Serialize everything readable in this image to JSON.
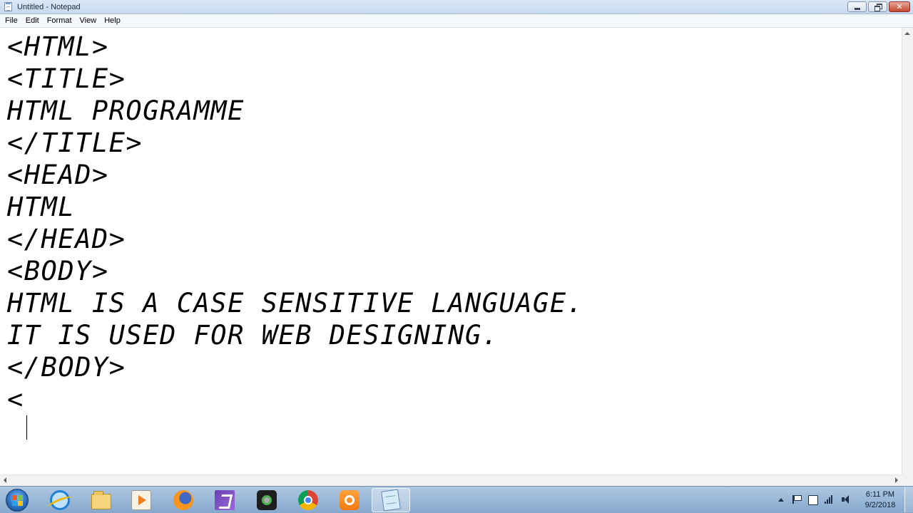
{
  "window": {
    "title": "Untitled - Notepad",
    "close_glyph": "✕"
  },
  "menu": [
    "File",
    "Edit",
    "Format",
    "View",
    "Help"
  ],
  "editor": {
    "lines": [
      "<HTML>",
      "<TITLE>",
      "HTML PROGRAMME",
      "</TITLE>",
      "<HEAD>",
      "HTML",
      "</HEAD>",
      "<BODY>",
      "HTML IS A CASE SENSITIVE LANGUAGE.",
      "IT IS USED FOR WEB DESIGNING.",
      "</BODY>",
      "<"
    ]
  },
  "taskbar": {
    "apps": [
      "internet-explorer-icon",
      "windows-explorer-icon",
      "media-player-icon",
      "firefox-icon",
      "visual-studio-icon",
      "camera-app-icon",
      "chrome-icon",
      "uc-browser-icon",
      "notepad-icon"
    ],
    "active_app": "notepad-icon",
    "clock": {
      "time": "6:11 PM",
      "date": "9/2/2018"
    }
  },
  "colors": {
    "titlebar": "#c7d9ee",
    "taskbar": "#86a8cd",
    "close_button": "#c4472f"
  }
}
